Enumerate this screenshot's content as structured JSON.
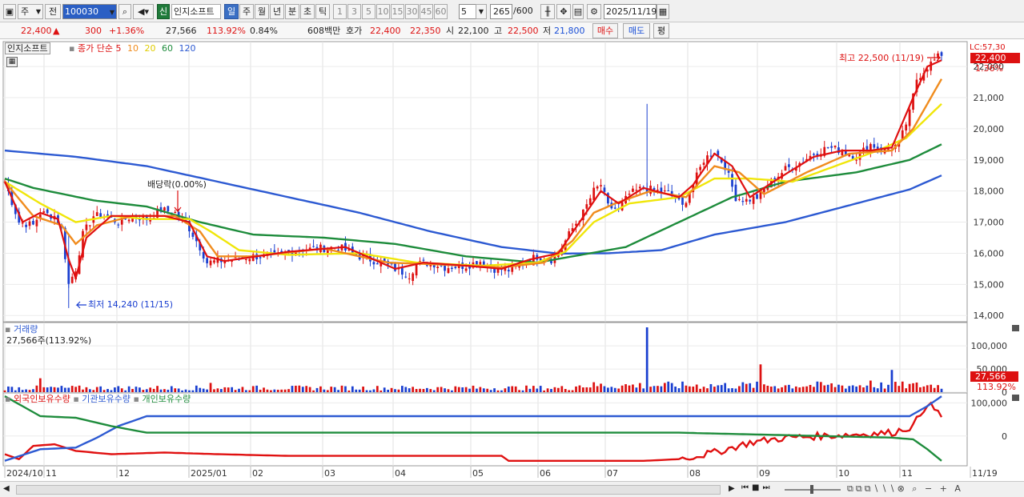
{
  "toolbar": {
    "type_selector": "주",
    "prev_label": "전",
    "code_value": "100030",
    "new_badge": "신",
    "stock_name": "인지소프트",
    "periods": [
      "일",
      "주",
      "월",
      "년",
      "분",
      "초",
      "틱"
    ],
    "period_active": "일",
    "intervals": [
      "1",
      "3",
      "5",
      "10",
      "15",
      "30",
      "45",
      "60"
    ],
    "interval_value": "5",
    "count_value": "265",
    "count_total": "/600",
    "date_value": "2025/11/19"
  },
  "quote": {
    "price": "22,400",
    "change": "300",
    "change_pct": "+1.36%",
    "volume": "27,566",
    "volume_ratio": "113.92%",
    "turnover": "0.84%",
    "amount": "608백만",
    "ask_label": "호가",
    "ask": "22,400",
    "bid": "22,350",
    "open_label": "시",
    "open": "22,100",
    "high_label": "고",
    "high": "22,500",
    "low_label": "저",
    "low": "21,800",
    "buy_label": "매수",
    "sell_label": "매도",
    "eval_label": "평"
  },
  "colors": {
    "ma5": "#e01010",
    "ma10": "#f08c1e",
    "ma20": "#f0e60a",
    "ma60": "#1e8c3c",
    "ma120": "#2d5ad2",
    "up": "#dd1111",
    "down": "#1a3fd0"
  },
  "chart_data": [
    {
      "type": "candlestick",
      "title": "인지소프트",
      "legend": [
        "종가 단순",
        "5",
        "10",
        "20",
        "60",
        "120"
      ],
      "x": [
        "2024/10",
        "11",
        "12",
        "2025/01",
        "02",
        "03",
        "04",
        "05",
        "06",
        "07",
        "08",
        "09",
        "10",
        "11",
        "11/19"
      ],
      "yticks": [
        14000,
        15000,
        16000,
        17000,
        18000,
        19000,
        20000,
        21000,
        22000
      ],
      "ylim": [
        13800,
        22800
      ],
      "price_level_tag": "LC:57,30",
      "last_price": "22,400",
      "last_change_pct": "1.36%",
      "annotations": {
        "high": "최고 22,500 (11/19)",
        "low": "최저 14,240 (11/15)",
        "dividend": "배당락(0.00%)"
      },
      "close_trajectory": [
        [
          0,
          18300
        ],
        [
          4,
          17000
        ],
        [
          8,
          16900
        ],
        [
          10,
          17300
        ],
        [
          14,
          17200
        ],
        [
          16,
          16800
        ],
        [
          17,
          15900
        ],
        [
          18,
          15000
        ],
        [
          20,
          15500
        ],
        [
          22,
          16600
        ],
        [
          25,
          17200
        ],
        [
          28,
          17200
        ],
        [
          32,
          17000
        ],
        [
          36,
          17200
        ],
        [
          40,
          17100
        ],
        [
          44,
          17400
        ],
        [
          48,
          17300
        ],
        [
          52,
          16800
        ],
        [
          55,
          16200
        ],
        [
          57,
          15700
        ],
        [
          60,
          15750
        ],
        [
          64,
          15800
        ],
        [
          70,
          15900
        ],
        [
          76,
          15900
        ],
        [
          82,
          16100
        ],
        [
          88,
          16150
        ],
        [
          94,
          16200
        ],
        [
          100,
          15900
        ],
        [
          106,
          15700
        ],
        [
          110,
          15500
        ],
        [
          114,
          15300
        ],
        [
          116,
          15650
        ],
        [
          120,
          15700
        ],
        [
          124,
          15550
        ],
        [
          130,
          15600
        ],
        [
          134,
          15750
        ],
        [
          138,
          15500
        ],
        [
          143,
          15450
        ],
        [
          146,
          15700
        ],
        [
          150,
          15900
        ],
        [
          154,
          15800
        ],
        [
          156,
          16000
        ],
        [
          160,
          16800
        ],
        [
          163,
          17300
        ],
        [
          166,
          18000
        ],
        [
          168,
          18200
        ],
        [
          170,
          17500
        ],
        [
          173,
          17400
        ],
        [
          176,
          17900
        ],
        [
          180,
          18100
        ],
        [
          184,
          18000
        ],
        [
          188,
          17900
        ],
        [
          191,
          17500
        ],
        [
          194,
          18200
        ],
        [
          197,
          19000
        ],
        [
          200,
          19300
        ],
        [
          203,
          18800
        ],
        [
          206,
          17800
        ],
        [
          209,
          17700
        ],
        [
          212,
          17800
        ],
        [
          216,
          18300
        ],
        [
          220,
          18700
        ],
        [
          224,
          18900
        ],
        [
          228,
          19200
        ],
        [
          232,
          19400
        ],
        [
          236,
          19300
        ],
        [
          240,
          19100
        ],
        [
          244,
          19500
        ],
        [
          248,
          19300
        ],
        [
          252,
          19500
        ],
        [
          255,
          20500
        ],
        [
          257,
          21600
        ],
        [
          260,
          22000
        ],
        [
          264,
          22400
        ]
      ],
      "ma_series": [
        {
          "name": "120",
          "points": [
            [
              0,
              19300
            ],
            [
              20,
              19100
            ],
            [
              40,
              18800
            ],
            [
              60,
              18300
            ],
            [
              80,
              17800
            ],
            [
              100,
              17300
            ],
            [
              120,
              16700
            ],
            [
              140,
              16200
            ],
            [
              156,
              15990
            ],
            [
              170,
              16000
            ],
            [
              185,
              16100
            ],
            [
              200,
              16600
            ],
            [
              220,
              17000
            ],
            [
              240,
              17600
            ],
            [
              255,
              18050
            ],
            [
              264,
              18500
            ]
          ]
        },
        {
          "name": "60",
          "points": [
            [
              0,
              18400
            ],
            [
              8,
              18100
            ],
            [
              25,
              17700
            ],
            [
              40,
              17500
            ],
            [
              55,
              17000
            ],
            [
              70,
              16600
            ],
            [
              90,
              16500
            ],
            [
              110,
              16300
            ],
            [
              130,
              15900
            ],
            [
              150,
              15700
            ],
            [
              160,
              15900
            ],
            [
              175,
              16200
            ],
            [
              190,
              17000
            ],
            [
              205,
              17800
            ],
            [
              220,
              18300
            ],
            [
              240,
              18600
            ],
            [
              255,
              19000
            ],
            [
              264,
              19500
            ]
          ]
        },
        {
          "name": "20",
          "points": [
            [
              0,
              18300
            ],
            [
              10,
              17600
            ],
            [
              20,
              17000
            ],
            [
              30,
              17200
            ],
            [
              40,
              17100
            ],
            [
              52,
              17100
            ],
            [
              58,
              16700
            ],
            [
              66,
              16100
            ],
            [
              80,
              15950
            ],
            [
              100,
              16000
            ],
            [
              116,
              15700
            ],
            [
              135,
              15600
            ],
            [
              150,
              15700
            ],
            [
              158,
              16050
            ],
            [
              166,
              17000
            ],
            [
              176,
              17600
            ],
            [
              190,
              17800
            ],
            [
              200,
              18400
            ],
            [
              210,
              18400
            ],
            [
              222,
              18300
            ],
            [
              234,
              18800
            ],
            [
              246,
              19300
            ],
            [
              254,
              19700
            ],
            [
              264,
              20800
            ]
          ]
        },
        {
          "name": "10",
          "points": [
            [
              0,
              18300
            ],
            [
              8,
              17200
            ],
            [
              16,
              16900
            ],
            [
              20,
              16300
            ],
            [
              26,
              16900
            ],
            [
              36,
              17200
            ],
            [
              48,
              17200
            ],
            [
              55,
              16700
            ],
            [
              60,
              15900
            ],
            [
              70,
              15900
            ],
            [
              90,
              16150
            ],
            [
              108,
              15700
            ],
            [
              120,
              15650
            ],
            [
              140,
              15550
            ],
            [
              152,
              15700
            ],
            [
              160,
              16400
            ],
            [
              166,
              17300
            ],
            [
              172,
              17600
            ],
            [
              182,
              18000
            ],
            [
              192,
              17800
            ],
            [
              200,
              18800
            ],
            [
              207,
              18600
            ],
            [
              214,
              17900
            ],
            [
              226,
              18600
            ],
            [
              238,
              19200
            ],
            [
              250,
              19300
            ],
            [
              256,
              20000
            ],
            [
              264,
              21600
            ]
          ]
        },
        {
          "name": "5",
          "points": [
            [
              0,
              18300
            ],
            [
              5,
              17000
            ],
            [
              10,
              17300
            ],
            [
              15,
              17100
            ],
            [
              18,
              15800
            ],
            [
              20,
              15200
            ],
            [
              23,
              16500
            ],
            [
              30,
              17200
            ],
            [
              45,
              17200
            ],
            [
              52,
              17000
            ],
            [
              57,
              15900
            ],
            [
              62,
              15750
            ],
            [
              80,
              16050
            ],
            [
              96,
              16200
            ],
            [
              110,
              15500
            ],
            [
              118,
              15700
            ],
            [
              130,
              15600
            ],
            [
              140,
              15500
            ],
            [
              148,
              15800
            ],
            [
              156,
              16000
            ],
            [
              162,
              17000
            ],
            [
              168,
              18000
            ],
            [
              173,
              17600
            ],
            [
              180,
              18100
            ],
            [
              190,
              17800
            ],
            [
              194,
              18200
            ],
            [
              200,
              19200
            ],
            [
              205,
              18800
            ],
            [
              210,
              17800
            ],
            [
              218,
              18400
            ],
            [
              228,
              19100
            ],
            [
              236,
              19300
            ],
            [
              244,
              19300
            ],
            [
              250,
              19400
            ],
            [
              256,
              21000
            ],
            [
              260,
              22000
            ],
            [
              264,
              22200
            ]
          ]
        }
      ]
    },
    {
      "type": "bar",
      "title": "거래량",
      "current": "27,566주(113.92%)",
      "yticks": [
        0,
        50000,
        100000
      ],
      "last_value": "27,566",
      "last_ratio": "113.92%",
      "spikes": [
        [
          181,
          140000
        ],
        [
          213,
          60000
        ],
        [
          250,
          48000
        ],
        [
          10,
          30000
        ],
        [
          58,
          20000
        ],
        [
          244,
          25000
        ]
      ],
      "base_volume": 9000
    },
    {
      "type": "line",
      "legend": [
        "외국인보유수량",
        "기관보유수량",
        "개인보유수량"
      ],
      "yticks": [
        0,
        100000
      ],
      "series": [
        {
          "name": "외국인보유수량",
          "points": [
            [
              0,
              -55000
            ],
            [
              4,
              -70000
            ],
            [
              8,
              -30000
            ],
            [
              14,
              -25000
            ],
            [
              20,
              -45000
            ],
            [
              30,
              -55000
            ],
            [
              45,
              -50000
            ],
            [
              60,
              -55000
            ],
            [
              80,
              -60000
            ],
            [
              100,
              -60000
            ],
            [
              120,
              -60000
            ],
            [
              140,
              -60000
            ],
            [
              142,
              -75000
            ],
            [
              160,
              -75000
            ],
            [
              180,
              -75000
            ],
            [
              190,
              -70000
            ],
            [
              200,
              -50000
            ],
            [
              210,
              -20000
            ],
            [
              220,
              -5000
            ],
            [
              230,
              0
            ],
            [
              240,
              5000
            ],
            [
              250,
              10000
            ],
            [
              256,
              30000
            ],
            [
              260,
              100000
            ],
            [
              262,
              80000
            ],
            [
              264,
              60000
            ]
          ]
        },
        {
          "name": "기관보유수량",
          "points": [
            [
              0,
              -75000
            ],
            [
              10,
              -40000
            ],
            [
              20,
              -35000
            ],
            [
              26,
              -5000
            ],
            [
              32,
              30000
            ],
            [
              40,
              60000
            ],
            [
              60,
              60000
            ],
            [
              100,
              60000
            ],
            [
              150,
              60000
            ],
            [
              200,
              60000
            ],
            [
              240,
              60000
            ],
            [
              255,
              60000
            ],
            [
              260,
              90000
            ],
            [
              264,
              120000
            ]
          ]
        },
        {
          "name": "개인보유수량",
          "points": [
            [
              0,
              120000
            ],
            [
              10,
              60000
            ],
            [
              20,
              55000
            ],
            [
              30,
              30000
            ],
            [
              40,
              10000
            ],
            [
              60,
              10000
            ],
            [
              100,
              10000
            ],
            [
              150,
              10000
            ],
            [
              190,
              10000
            ],
            [
              210,
              5000
            ],
            [
              230,
              0
            ],
            [
              250,
              -5000
            ],
            [
              256,
              -10000
            ],
            [
              260,
              -40000
            ],
            [
              264,
              -75000
            ]
          ]
        }
      ]
    }
  ]
}
